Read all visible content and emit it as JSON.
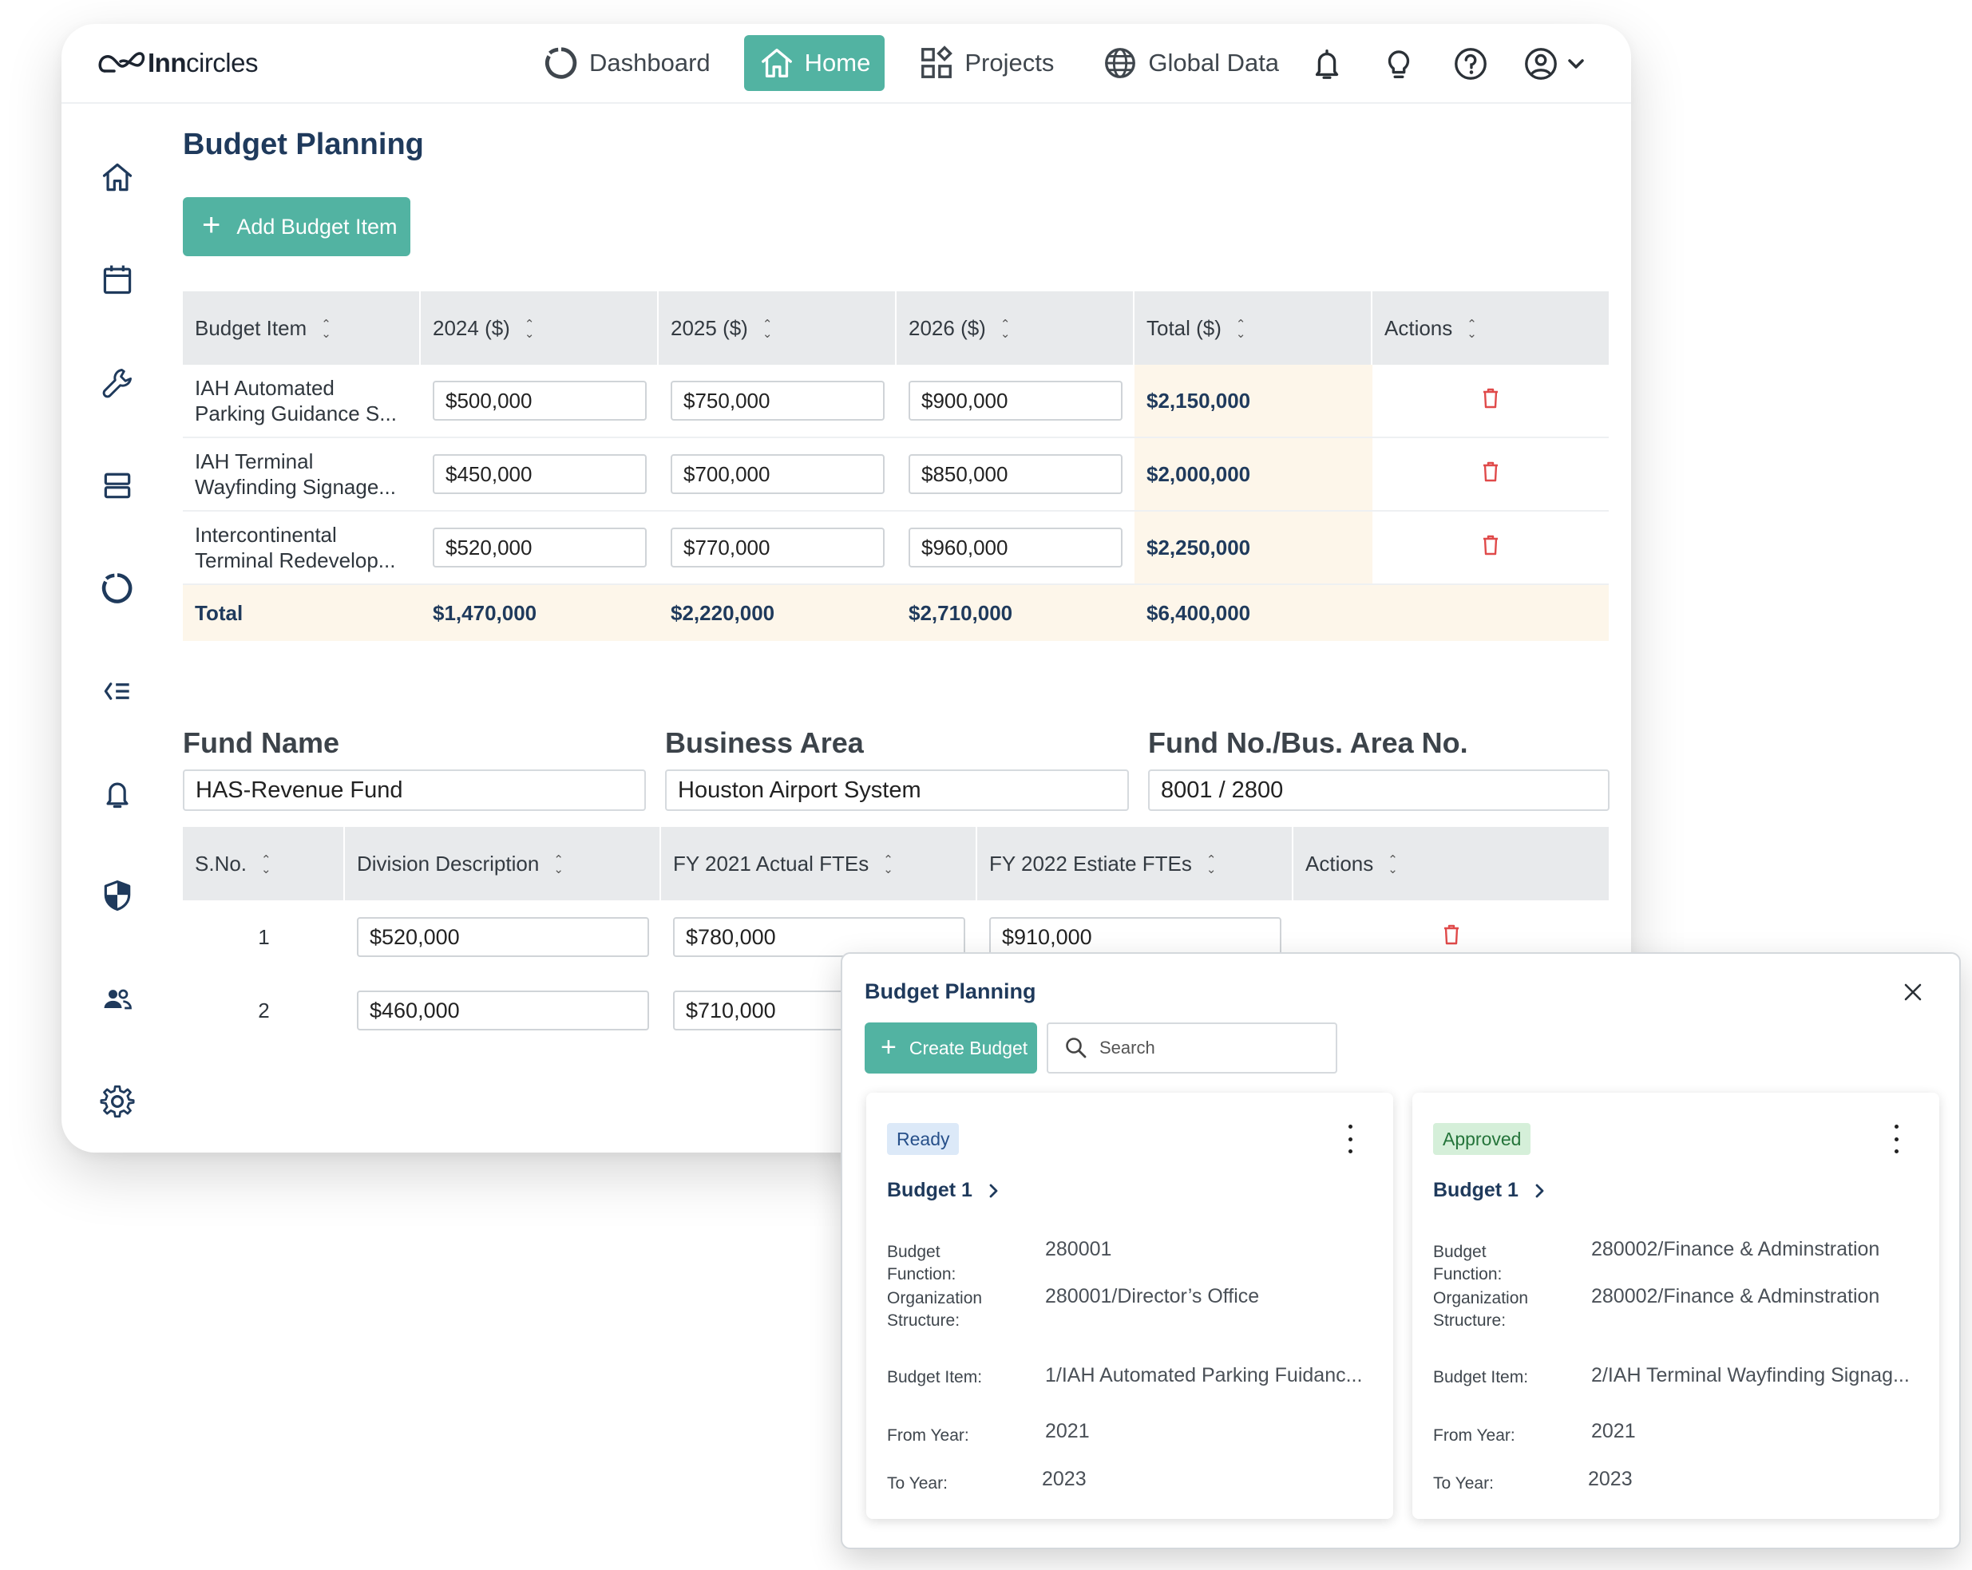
{
  "app": {
    "logo_text_bold": "Inn",
    "logo_text_rest": "circles"
  },
  "nav": {
    "items": [
      {
        "label": "Dashboard",
        "icon": "dashboard-ring-icon",
        "active": false
      },
      {
        "label": "Home",
        "icon": "home-icon",
        "active": true
      },
      {
        "label": "Projects",
        "icon": "grid-icon",
        "active": false
      },
      {
        "label": "Global Data",
        "icon": "globe-icon",
        "active": false
      }
    ],
    "right_icons": [
      "bell-icon",
      "lightbulb-icon",
      "help-icon",
      "user-icon",
      "chevron-down-icon"
    ]
  },
  "sidebar": {
    "icons": [
      "home-icon",
      "calendar-icon",
      "wrench-icon",
      "server-icon",
      "dashboard-ring-icon",
      "list-icon",
      "bell-icon",
      "shield-icon",
      "users-icon",
      "gear-icon"
    ]
  },
  "page": {
    "title": "Budget Planning",
    "add_button": "Add Budget Item"
  },
  "budget_table": {
    "columns": [
      "Budget Item",
      "2024 ($)",
      "2025 ($)",
      "2026 ($)",
      "Total ($)",
      "Actions"
    ],
    "rows": [
      {
        "item_line1": "IAH Automated",
        "item_line2": "Parking Guidance S...",
        "y2024": "$500,000",
        "y2025": "$750,000",
        "y2026": "$900,000",
        "total": "$2,150,000"
      },
      {
        "item_line1": "IAH Terminal",
        "item_line2": "Wayfinding Signage...",
        "y2024": "$450,000",
        "y2025": "$700,000",
        "y2026": "$850,000",
        "total": "$2,000,000"
      },
      {
        "item_line1": "Intercontinental",
        "item_line2": "Terminal Redevelop...",
        "y2024": "$520,000",
        "y2025": "$770,000",
        "y2026": "$960,000",
        "total": "$2,250,000"
      }
    ],
    "totals": {
      "label": "Total",
      "y2024": "$1,470,000",
      "y2025": "$2,220,000",
      "y2026": "$2,710,000",
      "total": "$6,400,000"
    }
  },
  "fund": {
    "fund_name_label": "Fund Name",
    "fund_name_value": "HAS-Revenue Fund",
    "business_area_label": "Business Area",
    "business_area_value": "Houston Airport System",
    "fund_no_label": "Fund No./Bus. Area No.",
    "fund_no_value": "8001 / 2800"
  },
  "division_table": {
    "columns": [
      "S.No.",
      "Division Description",
      "FY 2021 Actual FTEs",
      "FY 2022 Estiate FTEs",
      "Actions"
    ],
    "rows": [
      {
        "sno": "1",
        "desc": "$520,000",
        "fy2021": "$780,000",
        "fy2022": "$910,000"
      },
      {
        "sno": "2",
        "desc": "$460,000",
        "fy2021": "$710,000",
        "fy2022": ""
      }
    ]
  },
  "popup": {
    "title": "Budget Planning",
    "create_button": "Create Budget",
    "search_placeholder": "Search",
    "cards": [
      {
        "status": "Ready",
        "title": "Budget 1",
        "labels": {
          "function": "Budget Function:",
          "org_line1": "Organization",
          "org_line2": "Structure:",
          "item": "Budget Item:",
          "from": "From Year:",
          "to": "To Year:"
        },
        "function": "280001",
        "organization": "280001/Director’s Office",
        "budget_item": "1/IAH Automated Parking Fuidanc...",
        "from_year": "2021",
        "to_year": "2023"
      },
      {
        "status": "Approved",
        "title": "Budget 1",
        "labels": {
          "function": "Budget Function:",
          "org_line1": "Organization",
          "org_line2": "Structure:",
          "item": "Budget Item:",
          "from": "From Year:",
          "to": "To Year:"
        },
        "function": "280002/Finance & Adminstration",
        "organization": "280002/Finance & Adminstration",
        "budget_item": "2/IAH Terminal Wayfinding Signag...",
        "from_year": "2021",
        "to_year": "2023"
      }
    ]
  },
  "colors": {
    "accent": "#52b3a2",
    "title_navy": "#1f3a5c",
    "total_highlight": "#fdf6ea",
    "delete_red": "#e04a4a"
  }
}
